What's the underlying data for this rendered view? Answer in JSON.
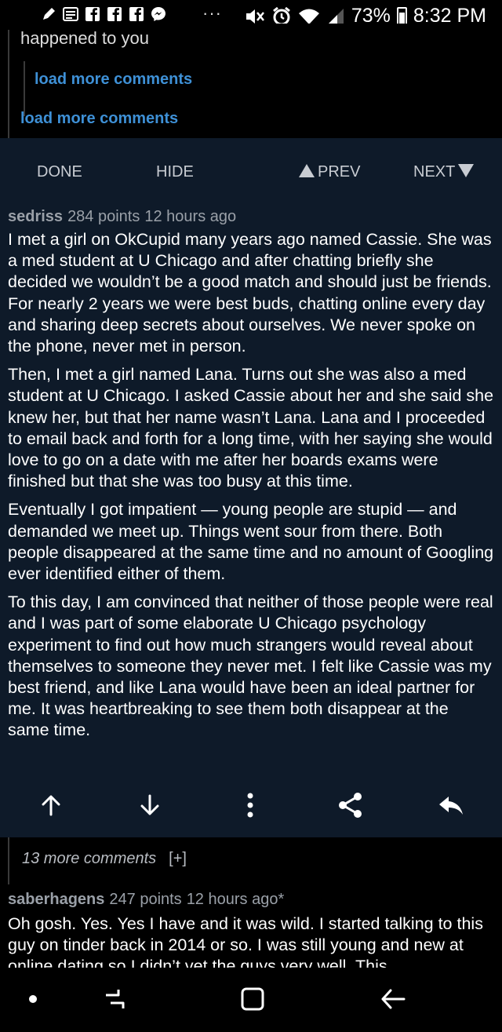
{
  "status_bar": {
    "notification_icons": [
      "pen-icon",
      "message-icon",
      "facebook-icon",
      "facebook-icon",
      "facebook-icon",
      "messenger-icon"
    ],
    "overflow": "···",
    "battery": "73%",
    "time": "8:32 PM"
  },
  "parent_thread": {
    "partial_text": "happened to you",
    "load_more_nested": "load more comments",
    "load_more": "load more comments"
  },
  "comment_nav": {
    "done": "DONE",
    "hide": "HIDE",
    "prev": "PREV",
    "next": "NEXT"
  },
  "comment": {
    "author": "sedriss",
    "points": "284 points",
    "age": "12 hours ago",
    "paragraphs": [
      "I met a girl on OkCupid many years ago named Cassie. She was a med student at U Chicago and after chatting briefly she decided we wouldn’t be a good match and should just be friends. For nearly 2 years we were best buds, chatting online every day and sharing deep secrets about ourselves. We never spoke on the phone, never met in person.",
      "Then, I met a girl named Lana. Turns out she was also a med student at U Chicago. I asked Cassie about her and she said she knew her, but that her name wasn’t Lana. Lana and I proceeded to email back and forth for a long time, with her saying she would love to go on a date with me after her boards exams were finished but that she was too busy at this time.",
      "Eventually I got impatient — young people are stupid — and demanded we meet up. Things went sour from there. Both people disappeared at the same time and no amount of Googling ever identified either of them.",
      "To this day, I am convinced that neither of those people were real and I was part of some elaborate U Chicago psychology experiment to find out how much strangers would reveal about themselves to someone they never met. I felt like Cassie was my best friend, and like Lana would have been an ideal partner for me. It was heartbreaking to see them both disappear at the same time."
    ],
    "actions": [
      "upvote-icon",
      "downvote-icon",
      "more-icon",
      "share-icon",
      "reply-icon"
    ]
  },
  "more_comments": {
    "label": "13 more comments",
    "expand": "[+]"
  },
  "next_comment": {
    "author": "saberhagens",
    "points": "247 points",
    "age": "12 hours ago*",
    "text": "Oh gosh. Yes. Yes I have and it was wild. I started talking to this guy on tinder back in 2014 or so. I was still young and new at online dating so I didn’t vet the guys very well. This"
  },
  "colors": {
    "link": "#3e90d6",
    "card_bg": "#0e1a29",
    "muted_text": "#9aa0a8"
  }
}
